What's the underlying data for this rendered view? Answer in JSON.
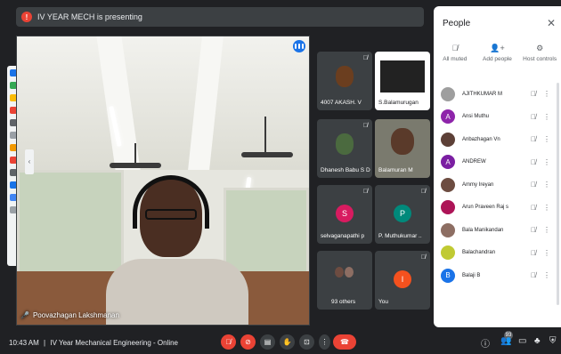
{
  "banner": {
    "text": "IV YEAR MECH is presenting",
    "icon": "present-icon"
  },
  "stage": {
    "name": "Poovazhagan Lakshmanan"
  },
  "tiles": [
    {
      "name": "4007 AKASH. V",
      "type": "photo"
    },
    {
      "name": "S.Balamurugan",
      "type": "screen"
    },
    {
      "name": "Dhanesh Babu S D",
      "type": "photo"
    },
    {
      "name": "Balamuran M",
      "type": "photo"
    },
    {
      "name": "selvaganapathi p",
      "initial": "S",
      "color": "#d81b60"
    },
    {
      "name": "P. Muthukumar ..",
      "initial": "P",
      "color": "#00897b"
    },
    {
      "name": "93 others",
      "type": "group"
    },
    {
      "name": "You",
      "initial": "I",
      "color": "#f4511e"
    }
  ],
  "people_panel": {
    "title": "People",
    "controls": [
      {
        "label": "All muted",
        "icon": "mic-off-icon"
      },
      {
        "label": "Add people",
        "icon": "add-person-icon"
      },
      {
        "label": "Host controls",
        "icon": "host-controls-icon"
      }
    ],
    "participants": [
      {
        "name": "AJITHKUMAR M",
        "initial": "",
        "color": "#9e9e9e"
      },
      {
        "name": "Ansi Muthu",
        "initial": "A",
        "color": "#8e24aa"
      },
      {
        "name": "Anbazhagan Vn",
        "initial": "",
        "color": "#5d4037"
      },
      {
        "name": "ANDREW",
        "initial": "A",
        "color": "#7b1fa2"
      },
      {
        "name": "Ammy Ireyan",
        "initial": "",
        "color": "#6d4c41"
      },
      {
        "name": "Arun Praveen Raj s",
        "initial": "",
        "color": "#ad1457"
      },
      {
        "name": "Bala Manikandan",
        "initial": "",
        "color": "#8d6e63"
      },
      {
        "name": "Balachandran",
        "initial": "",
        "color": "#c0ca33"
      },
      {
        "name": "Balaji B",
        "initial": "B",
        "color": "#1a73e8"
      }
    ]
  },
  "bottom_bar": {
    "time": "10:43 AM",
    "separator": "|",
    "meeting": "IV Year Mechanical Engineering - Online",
    "participant_count": "93"
  },
  "colors": {
    "end_call": "#ea4335",
    "panel_bg": "#ffffff",
    "bar_bg": "#202124"
  }
}
